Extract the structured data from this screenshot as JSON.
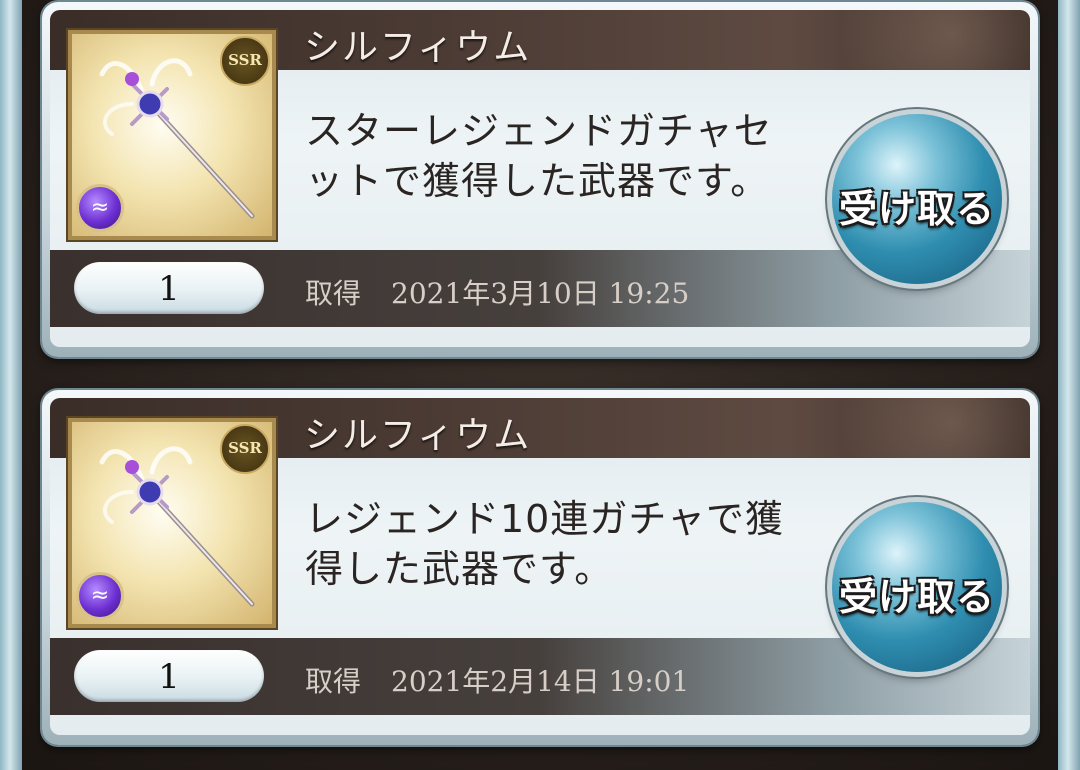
{
  "items": [
    {
      "name": "シルフィウム",
      "description_lines": [
        "スターレジェンドガチャセ",
        "ットで獲得した武器です。"
      ],
      "quantity": "1",
      "acquired_label": "取得",
      "acquired_date": "2021年3月10日 19:25",
      "rarity": "SSR",
      "element_icon": "wind-element-icon",
      "button_label": "受け取る"
    },
    {
      "name": "シルフィウム",
      "description_lines": [
        "レジェンド10連ガチャで獲",
        "得した武器です。"
      ],
      "quantity": "1",
      "acquired_label": "取得",
      "acquired_date": "2021年2月14日 19:01",
      "rarity": "SSR",
      "element_icon": "wind-element-icon",
      "button_label": "受け取る"
    }
  ],
  "colors": {
    "title_bar": "#4b3b34",
    "button": "#2f8eb0",
    "thumb_frame": "#a88a4e"
  }
}
